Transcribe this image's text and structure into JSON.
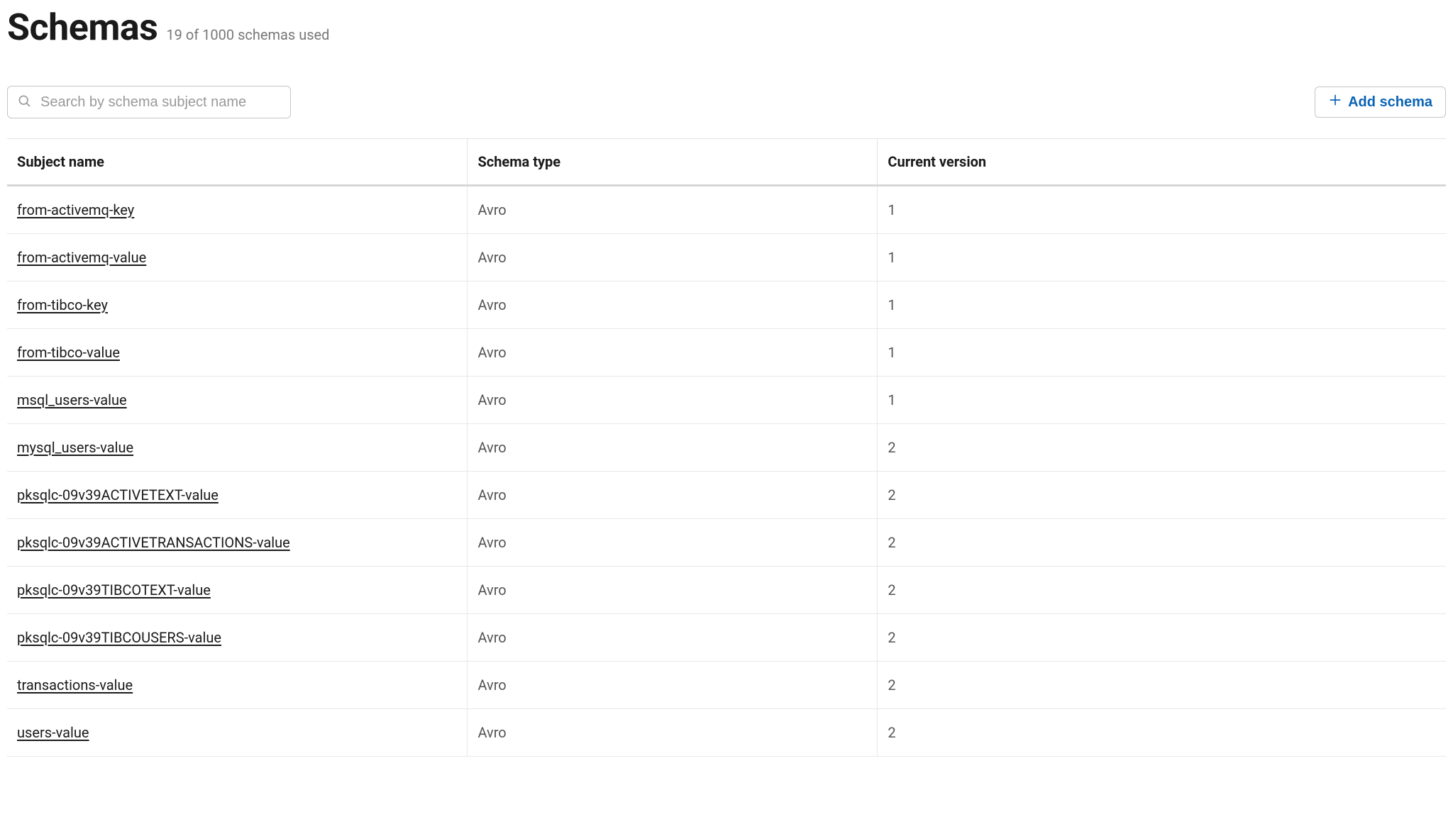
{
  "header": {
    "title": "Schemas",
    "subtitle": "19 of 1000 schemas used"
  },
  "toolbar": {
    "search_placeholder": "Search by schema subject name",
    "add_label": "Add schema"
  },
  "table": {
    "columns": {
      "subject": "Subject name",
      "type": "Schema type",
      "version": "Current version"
    },
    "rows": [
      {
        "subject": "from-activemq-key",
        "type": "Avro",
        "version": "1"
      },
      {
        "subject": "from-activemq-value",
        "type": "Avro",
        "version": "1"
      },
      {
        "subject": "from-tibco-key",
        "type": "Avro",
        "version": "1"
      },
      {
        "subject": "from-tibco-value",
        "type": "Avro",
        "version": "1"
      },
      {
        "subject": "msql_users-value",
        "type": "Avro",
        "version": "1"
      },
      {
        "subject": "mysql_users-value",
        "type": "Avro",
        "version": "2"
      },
      {
        "subject": "pksqlc-09v39ACTIVETEXT-value",
        "type": "Avro",
        "version": "2"
      },
      {
        "subject": "pksqlc-09v39ACTIVETRANSACTIONS-value",
        "type": "Avro",
        "version": "2"
      },
      {
        "subject": "pksqlc-09v39TIBCOTEXT-value",
        "type": "Avro",
        "version": "2"
      },
      {
        "subject": "pksqlc-09v39TIBCOUSERS-value",
        "type": "Avro",
        "version": "2"
      },
      {
        "subject": "transactions-value",
        "type": "Avro",
        "version": "2"
      },
      {
        "subject": "users-value",
        "type": "Avro",
        "version": "2"
      }
    ]
  }
}
